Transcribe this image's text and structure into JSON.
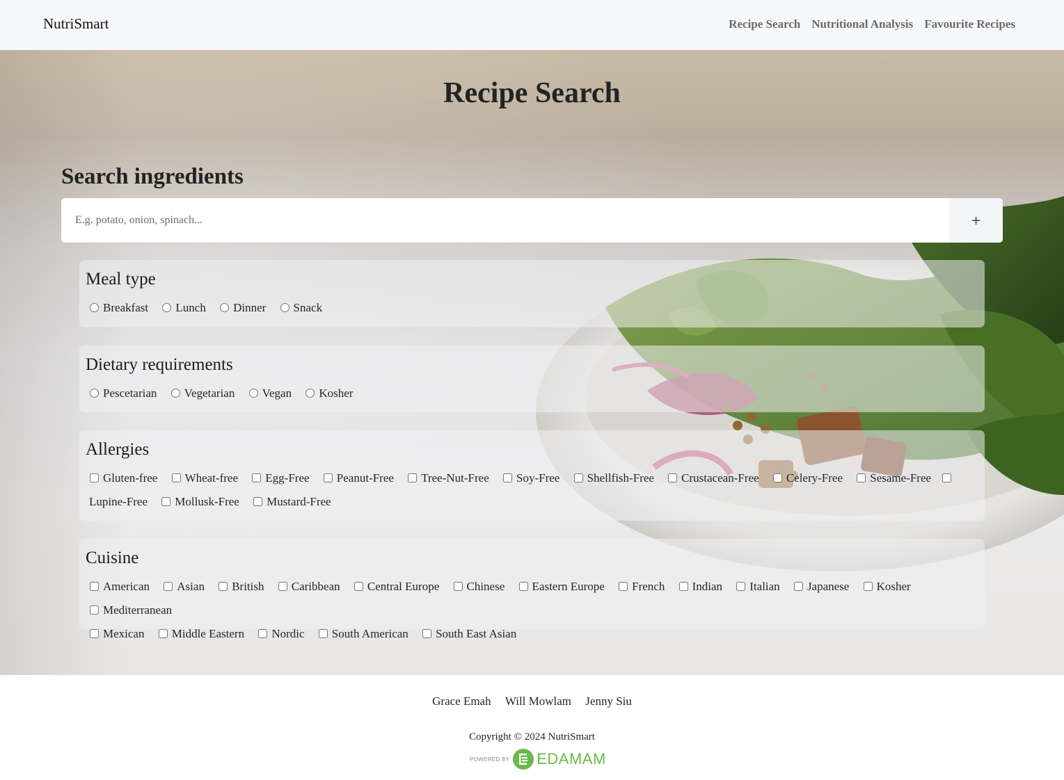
{
  "nav": {
    "brand": "NutriSmart",
    "links": [
      "Recipe Search",
      "Nutritional Analysis",
      "Favourite Recipes"
    ]
  },
  "main": {
    "title": "Recipe Search",
    "search_heading": "Search ingredients",
    "search_placeholder": "E.g. potato, onion, spinach...",
    "add_label": "+"
  },
  "filters": {
    "meal_type": {
      "title": "Meal type",
      "options": [
        "Breakfast",
        "Lunch",
        "Dinner",
        "Snack"
      ]
    },
    "dietary": {
      "title": "Dietary requirements",
      "options": [
        "Pescetarian",
        "Vegetarian",
        "Vegan",
        "Kosher"
      ]
    },
    "allergies": {
      "title": "Allergies",
      "options": [
        "Gluten-free",
        "Wheat-free",
        "Egg-Free",
        "Peanut-Free",
        "Tree-Nut-Free",
        "Soy-Free",
        "Shellfish-Free",
        "Crustacean-Free",
        "Celery-Free",
        "Sesame-Free",
        "Lupine-Free",
        "Mollusk-Free",
        "Mustard-Free"
      ]
    },
    "cuisine": {
      "title": "Cuisine",
      "options": [
        "American",
        "Asian",
        "British",
        "Caribbean",
        "Central Europe",
        "Chinese",
        "Eastern Europe",
        "French",
        "Indian",
        "Italian",
        "Japanese",
        "Kosher",
        "Mediterranean",
        "Mexican",
        "Middle Eastern",
        "Nordic",
        "South American",
        "South East Asian"
      ]
    }
  },
  "footer": {
    "authors": [
      "Grace Emah",
      "Will Mowlam",
      "Jenny Siu"
    ],
    "copyright": "Copyright © 2024 NutriSmart",
    "powered_by": "POWERED BY",
    "edamam": "EDAMAM"
  },
  "icons": {
    "add": "plus-icon",
    "edamam_logo": "edamam-logo-icon"
  },
  "colors": {
    "edamam_green": "#6cb84a",
    "nav_bg": "#f7f8fa",
    "nav_link": "#6a6a6a"
  }
}
